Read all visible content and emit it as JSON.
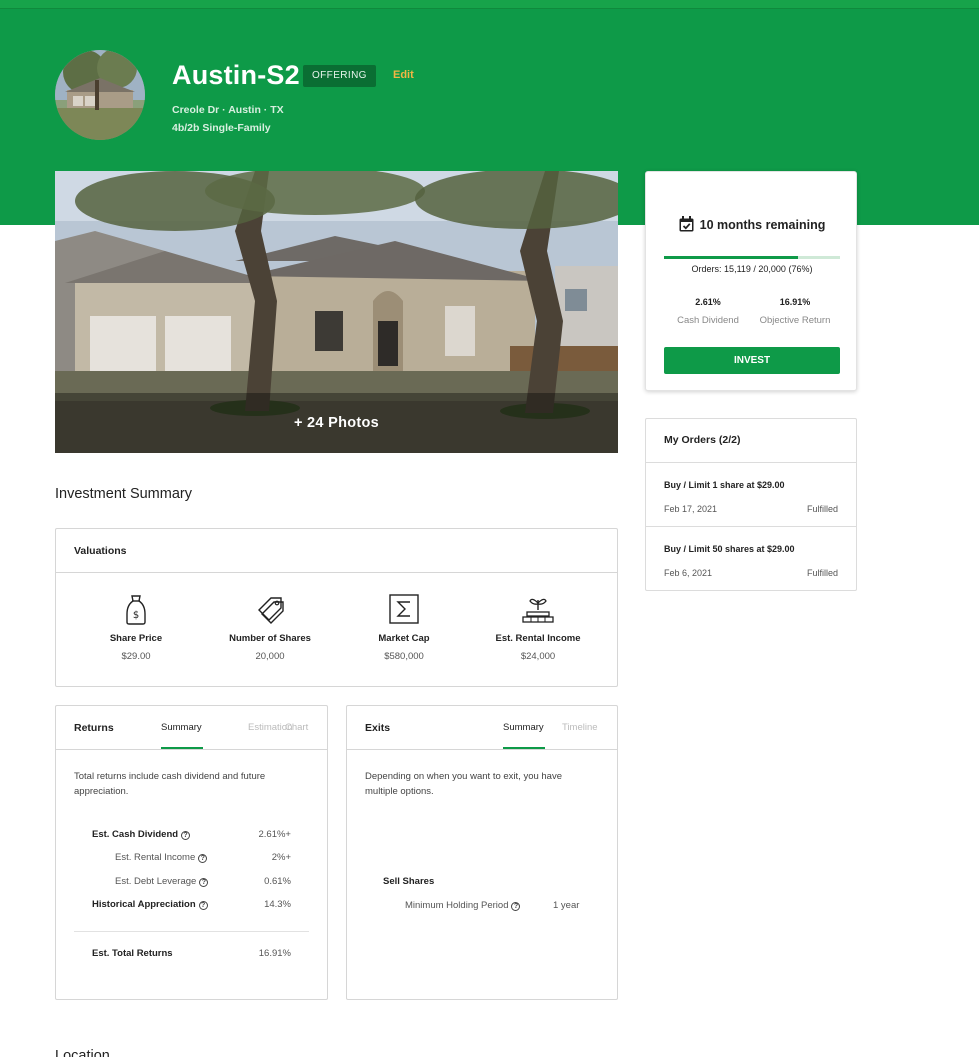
{
  "property": {
    "name": "Austin-S2",
    "status": "OFFERING",
    "edit_label": "Edit",
    "address": "Creole Dr · Austin · TX",
    "details": "4b/2b Single-Family",
    "photos_label": "+ 24 Photos"
  },
  "offering": {
    "remaining": "10 months remaining",
    "progress_fraction": 0.76,
    "orders_text": "Orders: 15,119 / 20,000 (76%)",
    "cash_dividend_value": "2.61%",
    "cash_dividend_label": "Cash Dividend",
    "objective_return_value": "16.91%",
    "objective_return_label": "Objective Return",
    "invest_label": "INVEST"
  },
  "my_orders": {
    "title": "My Orders (2/2)",
    "items": [
      {
        "desc": "Buy / Limit 1 share at $29.00",
        "date": "Feb 17, 2021",
        "status": "Fulfilled"
      },
      {
        "desc": "Buy / Limit 50 shares at $29.00",
        "date": "Feb 6, 2021",
        "status": "Fulfilled"
      }
    ]
  },
  "summary": {
    "heading": "Investment Summary",
    "valuations_title": "Valuations",
    "valuations": [
      {
        "label": "Share Price",
        "value": "$29.00",
        "icon": "price-tag-icon"
      },
      {
        "label": "Number of Shares",
        "value": "20,000",
        "icon": "tags-icon"
      },
      {
        "label": "Market Cap",
        "value": "$580,000",
        "icon": "sigma-icon"
      },
      {
        "label": "Est. Rental Income",
        "value": "$24,000",
        "icon": "plant-coins-icon"
      }
    ]
  },
  "returns": {
    "title": "Returns",
    "tabs": [
      "Summary",
      "Estimation",
      "Chart"
    ],
    "description": "Total returns include cash dividend and future appreciation.",
    "rows": [
      {
        "label": "Est. Cash Dividend",
        "value": "2.61%+"
      },
      {
        "label": "Est. Rental Income",
        "value": "2%+"
      },
      {
        "label": "Est. Debt Leverage",
        "value": "0.61%"
      },
      {
        "label": "Historical Appreciation",
        "value": "14.3%"
      }
    ],
    "total_label": "Est. Total Returns",
    "total_value": "16.91%"
  },
  "exits": {
    "title": "Exits",
    "tabs": [
      "Summary",
      "Timeline"
    ],
    "description": "Depending on when you want to exit, you have multiple options.",
    "sell_shares_label": "Sell Shares",
    "holding_label": "Minimum Holding Period",
    "holding_value": "1 year"
  },
  "location_heading": "Location"
}
